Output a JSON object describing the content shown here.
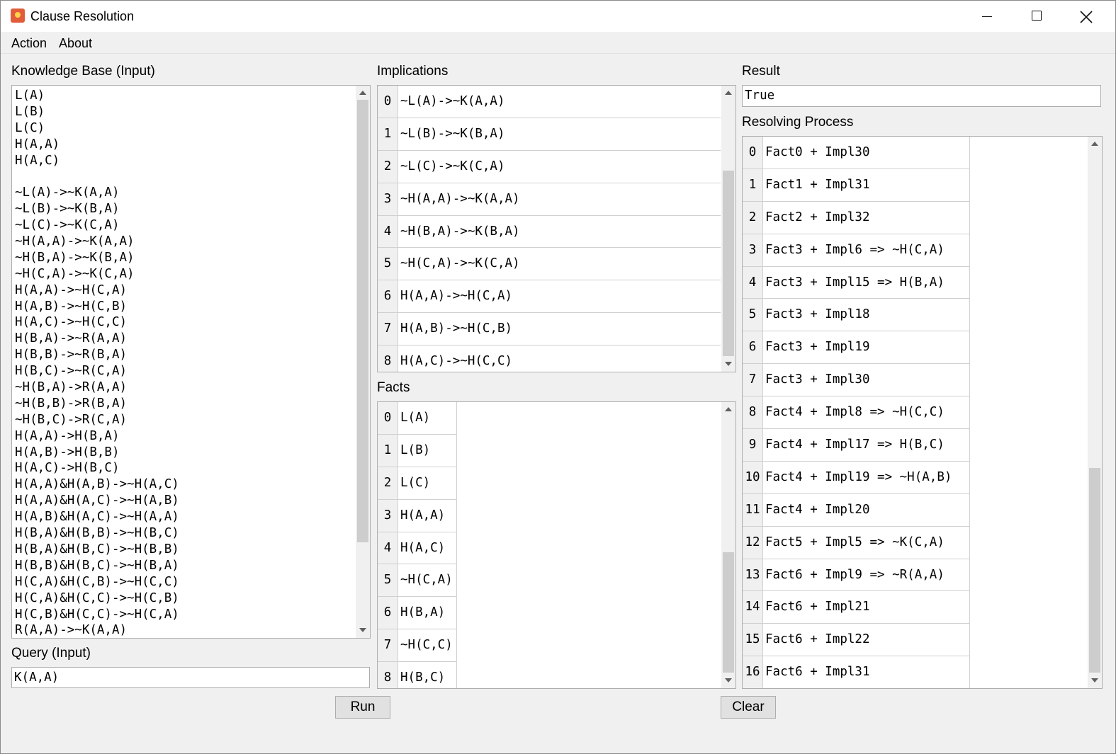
{
  "window": {
    "title": "Clause Resolution"
  },
  "menu": {
    "items": [
      "Action",
      "About"
    ]
  },
  "kb": {
    "label": "Knowledge Base (Input)",
    "lines": [
      "L(A)",
      "L(B)",
      "L(C)",
      "H(A,A)",
      "H(A,C)",
      "",
      "~L(A)->~K(A,A)",
      "~L(B)->~K(B,A)",
      "~L(C)->~K(C,A)",
      "~H(A,A)->~K(A,A)",
      "~H(B,A)->~K(B,A)",
      "~H(C,A)->~K(C,A)",
      "H(A,A)->~H(C,A)",
      "H(A,B)->~H(C,B)",
      "H(A,C)->~H(C,C)",
      "H(B,A)->~R(A,A)",
      "H(B,B)->~R(B,A)",
      "H(B,C)->~R(C,A)",
      "~H(B,A)->R(A,A)",
      "~H(B,B)->R(B,A)",
      "~H(B,C)->R(C,A)",
      "H(A,A)->H(B,A)",
      "H(A,B)->H(B,B)",
      "H(A,C)->H(B,C)",
      "H(A,A)&H(A,B)->~H(A,C)",
      "H(A,A)&H(A,C)->~H(A,B)",
      "H(A,B)&H(A,C)->~H(A,A)",
      "H(B,A)&H(B,B)->~H(B,C)",
      "H(B,A)&H(B,C)->~H(B,B)",
      "H(B,B)&H(B,C)->~H(B,A)",
      "H(C,A)&H(C,B)->~H(C,C)",
      "H(C,A)&H(C,C)->~H(C,B)",
      "H(C,B)&H(C,C)->~H(C,A)",
      "R(A,A)->~K(A,A)"
    ]
  },
  "query": {
    "label": "Query (Input)",
    "value": "K(A,A)"
  },
  "implications": {
    "label": "Implications",
    "rows": [
      {
        "idx": "0",
        "val": "~L(A)->~K(A,A)"
      },
      {
        "idx": "1",
        "val": "~L(B)->~K(B,A)"
      },
      {
        "idx": "2",
        "val": "~L(C)->~K(C,A)"
      },
      {
        "idx": "3",
        "val": "~H(A,A)->~K(A,A)"
      },
      {
        "idx": "4",
        "val": "~H(B,A)->~K(B,A)"
      },
      {
        "idx": "5",
        "val": "~H(C,A)->~K(C,A)"
      },
      {
        "idx": "6",
        "val": "H(A,A)->~H(C,A)"
      },
      {
        "idx": "7",
        "val": "H(A,B)->~H(C,B)"
      },
      {
        "idx": "8",
        "val": "H(A,C)->~H(C,C)"
      }
    ]
  },
  "facts": {
    "label": "Facts",
    "rows": [
      {
        "idx": "0",
        "val": "L(A)"
      },
      {
        "idx": "1",
        "val": "L(B)"
      },
      {
        "idx": "2",
        "val": "L(C)"
      },
      {
        "idx": "3",
        "val": "H(A,A)"
      },
      {
        "idx": "4",
        "val": "H(A,C)"
      },
      {
        "idx": "5",
        "val": "~H(C,A)"
      },
      {
        "idx": "6",
        "val": "H(B,A)"
      },
      {
        "idx": "7",
        "val": "~H(C,C)"
      },
      {
        "idx": "8",
        "val": "H(B,C)"
      }
    ]
  },
  "result": {
    "label": "Result",
    "value": "True"
  },
  "resolving": {
    "label": "Resolving Process",
    "rows": [
      {
        "idx": "0",
        "val": "Fact0 + Impl30"
      },
      {
        "idx": "1",
        "val": "Fact1 + Impl31"
      },
      {
        "idx": "2",
        "val": "Fact2 + Impl32"
      },
      {
        "idx": "3",
        "val": "Fact3 + Impl6 => ~H(C,A)"
      },
      {
        "idx": "4",
        "val": "Fact3 + Impl15 => H(B,A)"
      },
      {
        "idx": "5",
        "val": "Fact3 + Impl18"
      },
      {
        "idx": "6",
        "val": "Fact3 + Impl19"
      },
      {
        "idx": "7",
        "val": "Fact3 + Impl30"
      },
      {
        "idx": "8",
        "val": "Fact4 + Impl8 => ~H(C,C)"
      },
      {
        "idx": "9",
        "val": "Fact4 + Impl17 => H(B,C)"
      },
      {
        "idx": "10",
        "val": "Fact4 + Impl19 => ~H(A,B)"
      },
      {
        "idx": "11",
        "val": "Fact4 + Impl20"
      },
      {
        "idx": "12",
        "val": "Fact5 + Impl5 => ~K(C,A)"
      },
      {
        "idx": "13",
        "val": "Fact6 + Impl9 => ~R(A,A)"
      },
      {
        "idx": "14",
        "val": "Fact6 + Impl21"
      },
      {
        "idx": "15",
        "val": "Fact6 + Impl22"
      },
      {
        "idx": "16",
        "val": "Fact6 + Impl31"
      }
    ]
  },
  "buttons": {
    "run": "Run",
    "clear": "Clear"
  }
}
